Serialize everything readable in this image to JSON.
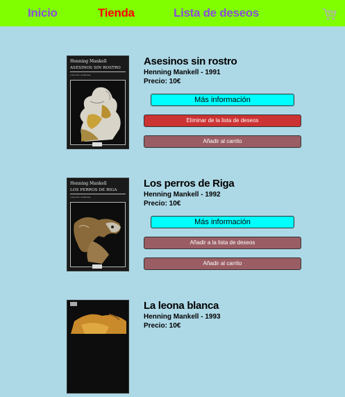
{
  "nav": {
    "inicio": "Inicio",
    "tienda": "Tienda",
    "lista_deseos": "Lista de deseos",
    "cart_icon": "shopping-cart-icon",
    "background_color": "#7fff00",
    "active_color": "#ff0000",
    "link_color": "#8a4fd6"
  },
  "page": {
    "background_color": "#add8e6"
  },
  "books": [
    {
      "title": "Asesinos sin rostro",
      "author_year": "Henning Mankell - 1991",
      "price": "Precio: 10€",
      "cover_author": "Henning Mankell",
      "cover_title": "ASESINOS SIN ROSTRO",
      "cover_collection": "colección andanzas",
      "info_button": "Más información",
      "wishlist_button": "Eliminar de la lista de deseos",
      "cart_button": "Añadir al carrito"
    },
    {
      "title": "Los perros de Riga",
      "author_year": "Henning Mankell - 1992",
      "price": "Precio: 10€",
      "cover_author": "Henning Mankell",
      "cover_title": "LOS PERROS DE RIGA",
      "cover_collection": "colección andanzas",
      "info_button": "Más información",
      "wishlist_button": "Añadir a la lista de deseos",
      "cart_button": "Añadir al carrito"
    },
    {
      "title": "La leona blanca",
      "author_year": "Henning Mankell - 1993",
      "price": "Precio: 10€"
    }
  ],
  "colors": {
    "info_button": "#00ffff",
    "remove_button": "#cc3333",
    "secondary_button": "#995d63"
  }
}
